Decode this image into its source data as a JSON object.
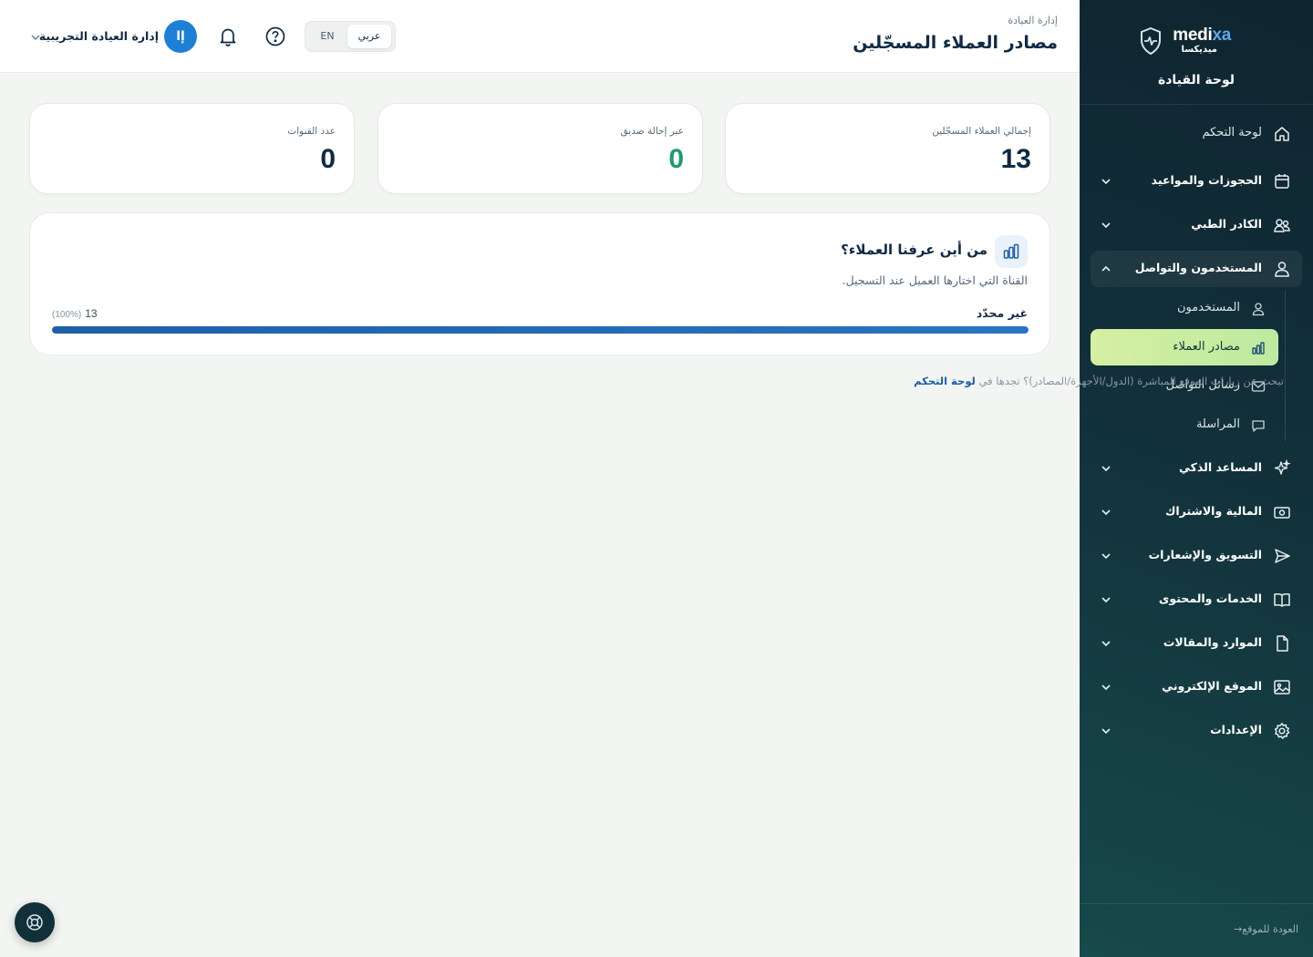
{
  "sidebar": {
    "brand_wordmark_a": "medi",
    "brand_wordmark_b": "xa",
    "brand_arabic": "ميديكسا",
    "title": "لوحة القيادة",
    "items": [
      {
        "label": "لوحة التحكم",
        "icon": "home-icon",
        "has_chevron": false
      },
      {
        "label": "الحجوزات والمواعيد",
        "icon": "calendar-icon",
        "has_chevron": true
      },
      {
        "label": "الكادر الطبي",
        "icon": "staff-icon",
        "has_chevron": true
      },
      {
        "label": "المستخدمون والتواصل",
        "icon": "user-icon",
        "has_chevron": true,
        "expanded": true
      },
      {
        "label": "المساعد الذكي",
        "icon": "sparkle-icon",
        "has_chevron": true
      },
      {
        "label": "المالية والاشتراك",
        "icon": "money-icon",
        "has_chevron": true
      },
      {
        "label": "التسويق والإشعارات",
        "icon": "send-icon",
        "has_chevron": true
      },
      {
        "label": "الخدمات والمحتوى",
        "icon": "book-icon",
        "has_chevron": true
      },
      {
        "label": "الموارد والمقالات",
        "icon": "file-icon",
        "has_chevron": true
      },
      {
        "label": "الموقع الإلكتروني",
        "icon": "image-icon",
        "has_chevron": true
      },
      {
        "label": "الإعدادات",
        "icon": "gear-icon",
        "has_chevron": true
      }
    ],
    "subitems": [
      {
        "label": "المستخدمون",
        "icon": "user-icon"
      },
      {
        "label": "مصادر العملاء",
        "icon": "bar-chart-icon",
        "active": true
      },
      {
        "label": "رسائل التواصل",
        "icon": "mail-icon"
      },
      {
        "label": "المراسلة",
        "icon": "chat-icon"
      }
    ],
    "back_link": "العودة للموقع"
  },
  "header": {
    "breadcrumb": "إدارة العيادة",
    "title": "مصادر العملاء المسجّلين",
    "lang_ar": "عربي",
    "lang_en": "EN",
    "user_initial": "إا",
    "user_name": "إدارة العيادة التجريبية"
  },
  "stats": [
    {
      "label": "إجمالي العملاء المسجّلين",
      "value": "13"
    },
    {
      "label": "عبر إحالة صديق",
      "value": "0"
    },
    {
      "label": "عدد القنوات",
      "value": "0"
    }
  ],
  "panel": {
    "title": "من أين عرفنا العملاء؟",
    "description": "القناة التي اختارها العميل عند التسجيل.",
    "rows": [
      {
        "label": "غير محدّد",
        "count": "13",
        "percent_text": "(100%)",
        "share": 1.0
      }
    ]
  },
  "hint": {
    "text": "تبحث عن زيارات الموقع المباشرة (الدول/الأجهزة/المصادر)؟ تجدها في ",
    "link": "لوحة التحكم"
  },
  "colors": {
    "sidebar_bg": "#12303a",
    "accent_blue": "#1f5fa8",
    "active_sub_bg": "#cfeea1",
    "positive_green": "#1b9c6e"
  }
}
